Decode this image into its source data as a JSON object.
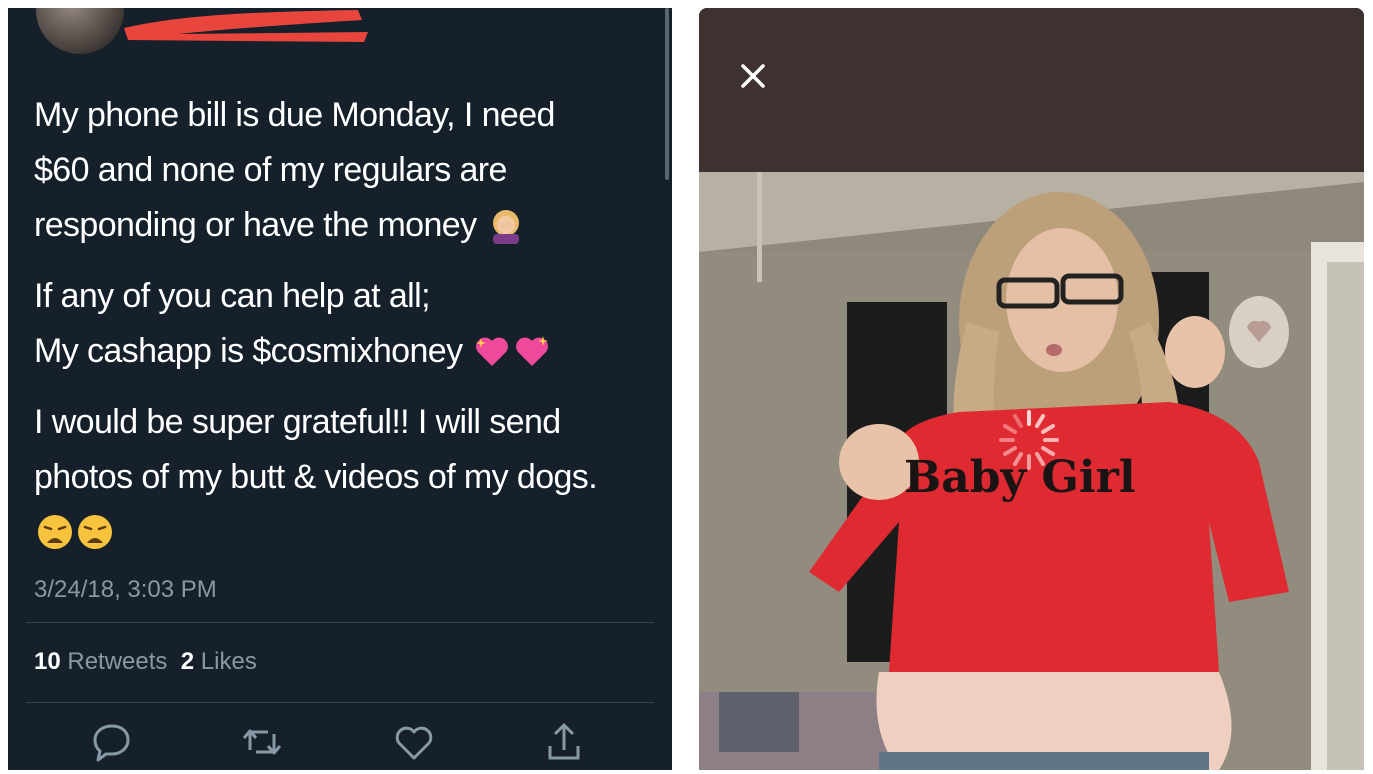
{
  "tweet": {
    "paragraphs": [
      [
        "My phone bill is due Monday, I need",
        "$60 and none of my regulars are",
        "responding or have the money"
      ],
      [
        "If any of you can help at all;",
        "My cashapp is $cosmixhoney"
      ],
      [
        "I would be super grateful!! I will send",
        "photos of my butt & videos of my dogs."
      ]
    ],
    "emojis": [
      "person-facepalming-emoji",
      "sparkling-heart-emoji",
      "weary-face-emoji"
    ],
    "timestamp": "3/24/18, 3:03 PM",
    "retweets_count": "10",
    "retweets_label": "Retweets",
    "likes_count": "2",
    "likes_label": "Likes",
    "actions": [
      "reply-icon",
      "retweet-icon",
      "like-icon",
      "share-icon"
    ]
  },
  "photo_viewer": {
    "close_icon": "close-icon",
    "shirt_text": "Baby Girl",
    "loading_icon": "loading-spinner-icon"
  },
  "colors": {
    "tweet_bg": "#15202b",
    "secondary_text": "#8899a6",
    "divider": "#38444d",
    "viewer_bar": "#3e3230",
    "shirt_red": "#e02a32",
    "redaction": "#e8453c"
  }
}
